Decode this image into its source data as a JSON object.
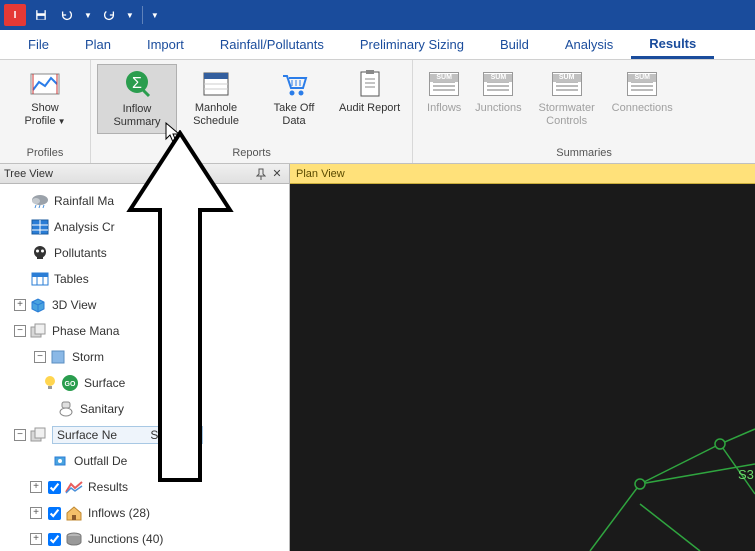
{
  "titlebar": {
    "app_abbrev": "I"
  },
  "menu": {
    "tabs": [
      "File",
      "Plan",
      "Import",
      "Rainfall/Pollutants",
      "Preliminary Sizing",
      "Build",
      "Analysis",
      "Results"
    ],
    "active_index": 7
  },
  "ribbon": {
    "groups": [
      {
        "label": "Profiles",
        "items": [
          {
            "id": "show-profile",
            "label": "Show Profile",
            "has_dropdown": true
          }
        ]
      },
      {
        "label": "Reports",
        "items": [
          {
            "id": "inflow-summary",
            "label": "Inflow Summary",
            "selected": true
          },
          {
            "id": "manhole-schedule",
            "label": "Manhole Schedule"
          },
          {
            "id": "take-off-data",
            "label": "Take Off Data"
          },
          {
            "id": "audit-report",
            "label": "Audit Report"
          }
        ]
      },
      {
        "label": "Summaries",
        "items": [
          {
            "id": "inflows-sum",
            "label": "Inflows",
            "disabled": true,
            "sum": true
          },
          {
            "id": "junctions-sum",
            "label": "Junctions",
            "disabled": true,
            "sum": true
          },
          {
            "id": "stormwater-controls",
            "label": "Stormwater Controls",
            "disabled": true,
            "sum": true
          },
          {
            "id": "connections-sum",
            "label": "Connections",
            "disabled": true,
            "sum": true
          }
        ]
      }
    ]
  },
  "tree": {
    "title": "Tree View",
    "items": [
      {
        "indent": 1,
        "label": "Rainfall Ma",
        "icon": "cloud"
      },
      {
        "indent": 1,
        "label": "Analysis Cr",
        "icon": "grid"
      },
      {
        "indent": 1,
        "label": "Pollutants",
        "icon": "skull"
      },
      {
        "indent": 1,
        "label": "Tables",
        "icon": "table"
      },
      {
        "indent": 0,
        "expander": "+",
        "label": "3D View",
        "icon": "cube"
      },
      {
        "indent": 0,
        "expander": "-",
        "label": "Phase Mana",
        "icon": "swatch"
      },
      {
        "indent": 1,
        "expander": "-",
        "label": "Storm",
        "icon": "swatch-blue"
      },
      {
        "indent": 2,
        "label": "Surface             1",
        "icon": "go"
      },
      {
        "indent": 2,
        "label": "Sanitary",
        "icon": "toilet"
      },
      {
        "indent": 0,
        "expander": "-",
        "label_select": "Surface Ne          Storm)",
        "icon": "swatch"
      },
      {
        "indent": 2,
        "label": "Outfall De",
        "icon": "valve"
      },
      {
        "indent": 1,
        "expander": "+",
        "checkbox": true,
        "checked": true,
        "label": "Results",
        "icon": "chart"
      },
      {
        "indent": 1,
        "expander": "+",
        "checkbox": true,
        "checked": true,
        "label": "Inflows (28)",
        "icon": "house"
      },
      {
        "indent": 1,
        "expander": "+",
        "checkbox": true,
        "checked": true,
        "label": "Junctions (40)",
        "icon": "manhole"
      }
    ]
  },
  "plan": {
    "title": "Plan View",
    "node_label": "S3"
  }
}
